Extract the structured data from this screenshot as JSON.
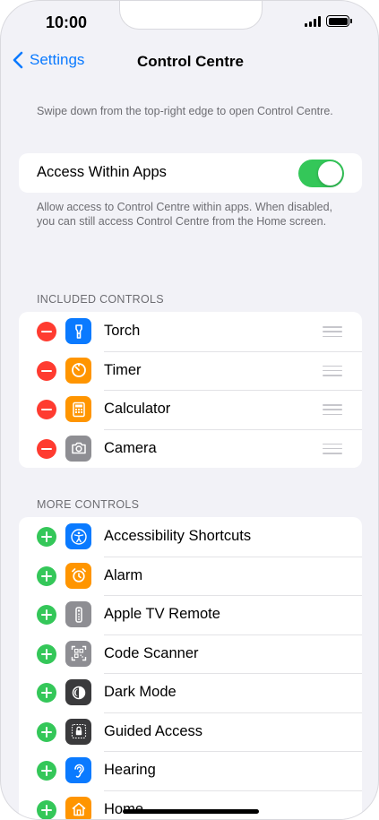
{
  "status_bar": {
    "time": "10:00"
  },
  "nav": {
    "back_label": "Settings",
    "title": "Control Centre"
  },
  "intro_text": "Swipe down from the top-right edge to open Control Centre.",
  "access_within_apps": {
    "label": "Access Within Apps",
    "enabled": true,
    "footnote": "Allow access to Control Centre within apps. When disabled, you can still access Control Centre from the Home screen."
  },
  "included_controls": {
    "header": "INCLUDED CONTROLS",
    "items": [
      {
        "label": "Torch",
        "icon": "torch-icon",
        "color": "#0a7aff"
      },
      {
        "label": "Timer",
        "icon": "timer-icon",
        "color": "#ff9500"
      },
      {
        "label": "Calculator",
        "icon": "calculator-icon",
        "color": "#ff9500"
      },
      {
        "label": "Camera",
        "icon": "camera-icon",
        "color": "#8e8e93"
      }
    ]
  },
  "more_controls": {
    "header": "MORE CONTROLS",
    "items": [
      {
        "label": "Accessibility Shortcuts",
        "icon": "accessibility-icon",
        "color": "#0a7aff"
      },
      {
        "label": "Alarm",
        "icon": "alarm-icon",
        "color": "#ff9500"
      },
      {
        "label": "Apple TV Remote",
        "icon": "remote-icon",
        "color": "#8e8e93"
      },
      {
        "label": "Code Scanner",
        "icon": "qr-code-icon",
        "color": "#8e8e93"
      },
      {
        "label": "Dark Mode",
        "icon": "dark-mode-icon",
        "color": "#3a3a3c"
      },
      {
        "label": "Guided Access",
        "icon": "lock-icon",
        "color": "#3a3a3c"
      },
      {
        "label": "Hearing",
        "icon": "ear-icon",
        "color": "#0a7aff"
      },
      {
        "label": "Home",
        "icon": "home-icon",
        "color": "#ff9500"
      }
    ]
  }
}
